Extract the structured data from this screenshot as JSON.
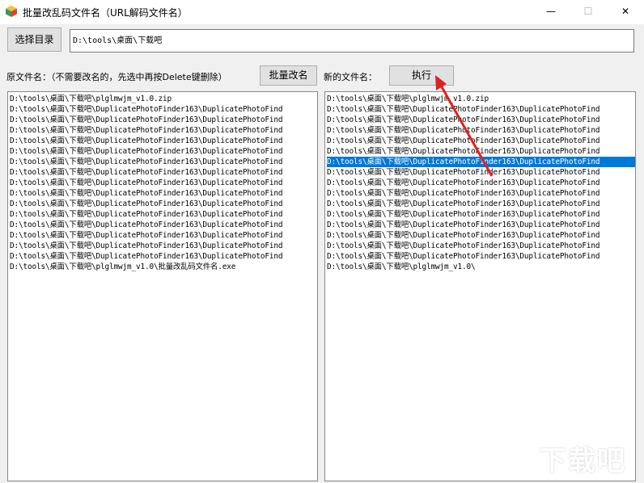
{
  "window": {
    "title": "批量改乱码文件名（URL解码文件名）",
    "controls": {
      "minimize": "—",
      "maximize": "☐",
      "close": "✕"
    }
  },
  "toolbar": {
    "choose_dir_label": "选择目录",
    "path_value": "D:\\tools\\桌面\\下载吧"
  },
  "labels": {
    "original_filename": "原文件名：（不需要改名的，先选中再按Delete键删除）",
    "batch_rename": "批量改名",
    "new_filename": "新的文件名：",
    "execute": "执行"
  },
  "lists": {
    "original": [
      "D:\\tools\\桌面\\下载吧\\plglmwjm_v1.0.zip",
      "D:\\tools\\桌面\\下载吧\\DuplicatePhotoFinder163\\DuplicatePhotoFind",
      "D:\\tools\\桌面\\下载吧\\DuplicatePhotoFinder163\\DuplicatePhotoFind",
      "D:\\tools\\桌面\\下载吧\\DuplicatePhotoFinder163\\DuplicatePhotoFind",
      "D:\\tools\\桌面\\下载吧\\DuplicatePhotoFinder163\\DuplicatePhotoFind",
      "D:\\tools\\桌面\\下载吧\\DuplicatePhotoFinder163\\DuplicatePhotoFind",
      "D:\\tools\\桌面\\下载吧\\DuplicatePhotoFinder163\\DuplicatePhotoFind",
      "D:\\tools\\桌面\\下载吧\\DuplicatePhotoFinder163\\DuplicatePhotoFind",
      "D:\\tools\\桌面\\下载吧\\DuplicatePhotoFinder163\\DuplicatePhotoFind",
      "D:\\tools\\桌面\\下载吧\\DuplicatePhotoFinder163\\DuplicatePhotoFind",
      "D:\\tools\\桌面\\下载吧\\DuplicatePhotoFinder163\\DuplicatePhotoFind",
      "D:\\tools\\桌面\\下载吧\\DuplicatePhotoFinder163\\DuplicatePhotoFind",
      "D:\\tools\\桌面\\下载吧\\DuplicatePhotoFinder163\\DuplicatePhotoFind",
      "D:\\tools\\桌面\\下载吧\\DuplicatePhotoFinder163\\DuplicatePhotoFind",
      "D:\\tools\\桌面\\下载吧\\DuplicatePhotoFinder163\\DuplicatePhotoFind",
      "D:\\tools\\桌面\\下载吧\\DuplicatePhotoFinder163\\DuplicatePhotoFind",
      "D:\\tools\\桌面\\下载吧\\plglmwjm_v1.0\\批量改乱码文件名.exe"
    ],
    "renamed": [
      "D:\\tools\\桌面\\下载吧\\plglmwjm_v1.0.zip",
      "D:\\tools\\桌面\\下载吧\\DuplicatePhotoFinder163\\DuplicatePhotoFind",
      "D:\\tools\\桌面\\下载吧\\DuplicatePhotoFinder163\\DuplicatePhotoFind",
      "D:\\tools\\桌面\\下载吧\\DuplicatePhotoFinder163\\DuplicatePhotoFind",
      "D:\\tools\\桌面\\下载吧\\DuplicatePhotoFinder163\\DuplicatePhotoFind",
      "D:\\tools\\桌面\\下载吧\\DuplicatePhotoFinder163\\DuplicatePhotoFind",
      "D:\\tools\\桌面\\下载吧\\DuplicatePhotoFinder163\\DuplicatePhotoFind",
      "D:\\tools\\桌面\\下载吧\\DuplicatePhotoFinder163\\DuplicatePhotoFind",
      "D:\\tools\\桌面\\下载吧\\DuplicatePhotoFinder163\\DuplicatePhotoFind",
      "D:\\tools\\桌面\\下载吧\\DuplicatePhotoFinder163\\DuplicatePhotoFind",
      "D:\\tools\\桌面\\下载吧\\DuplicatePhotoFinder163\\DuplicatePhotoFind",
      "D:\\tools\\桌面\\下载吧\\DuplicatePhotoFinder163\\DuplicatePhotoFind",
      "D:\\tools\\桌面\\下载吧\\DuplicatePhotoFinder163\\DuplicatePhotoFind",
      "D:\\tools\\桌面\\下载吧\\DuplicatePhotoFinder163\\DuplicatePhotoFind",
      "D:\\tools\\桌面\\下载吧\\DuplicatePhotoFinder163\\DuplicatePhotoFind",
      "D:\\tools\\桌面\\下载吧\\DuplicatePhotoFinder163\\DuplicatePhotoFind",
      "D:\\tools\\桌面\\下载吧\\plglmwjm_v1.0\\"
    ],
    "renamed_selected_index": 6
  },
  "colors": {
    "selection": "#0078d7",
    "annotation_arrow": "#e02020"
  },
  "icons": {
    "app": "app-cube-icon",
    "minimize": "minimize-icon",
    "maximize": "maximize-icon",
    "close": "close-icon"
  }
}
